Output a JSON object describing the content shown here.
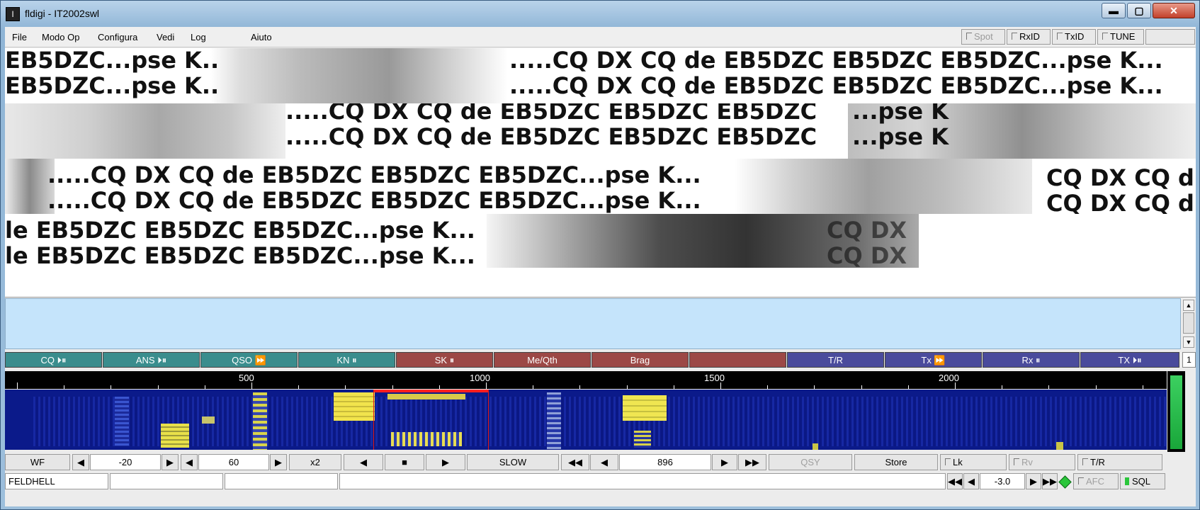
{
  "window": {
    "title": "fldigi - IT2002swl",
    "icon": "fldigi-app-icon",
    "min_glyph": "▬",
    "max_glyph": "▢",
    "close_glyph": "✕"
  },
  "menu": {
    "file": "File",
    "mode": "Modo Op",
    "config": "Configura",
    "view": "Vedi",
    "log": "Log",
    "help": "Aiuto"
  },
  "toolbar": {
    "spot": "Spot",
    "rxid": "RxID",
    "txid": "TxID",
    "tune": "TUNE"
  },
  "rx_text": {
    "cq_line": ".....CQ DX CQ de EB5DZC EB5DZC EB5DZC...pse K...",
    "frag_a": "EB5DZC...pse K...",
    "frag_b": ".....CQ DX CQ de EB5DZC EB5DZC EB5DZC",
    "frag_c": "...pse K",
    "frag_d": ".....CQ DX CQ de EB5DZC EB5DZC EB5DZC...pse K...",
    "frag_e": "CQ DX CQ d",
    "frag_f": "le EB5DZC EB5DZC EB5DZC...pse K...",
    "frag_g": "CQ DX"
  },
  "macros": [
    {
      "label": "CQ ⏵⏸",
      "color": "teal"
    },
    {
      "label": "ANS ⏵⏸",
      "color": "teal"
    },
    {
      "label": "QSO ⏩",
      "color": "teal"
    },
    {
      "label": "KN ⏸",
      "color": "teal"
    },
    {
      "label": "SK ⏸",
      "color": "red"
    },
    {
      "label": "Me/Qth",
      "color": "red"
    },
    {
      "label": "Brag",
      "color": "red"
    },
    {
      "label": "",
      "color": "red"
    },
    {
      "label": "T/R",
      "color": "blue"
    },
    {
      "label": "Tx ⏩",
      "color": "blue"
    },
    {
      "label": "Rx ⏸",
      "color": "blue"
    },
    {
      "label": "TX ⏵⏸",
      "color": "blue"
    }
  ],
  "macro_page": "1",
  "scale": {
    "labels": [
      "500",
      "1000",
      "1500",
      "2000"
    ]
  },
  "controls": {
    "wf": "WF",
    "reflevel": "-20",
    "range": "60",
    "zoom": "x2",
    "speed": "SLOW",
    "freq": "896",
    "qsy": "QSY",
    "store": "Store",
    "lk": "Lk",
    "rv": "Rv",
    "tr": "T/R"
  },
  "status": {
    "mode": "FELDHELL",
    "offset": "-3.0",
    "afc": "AFC",
    "sql": "SQL"
  }
}
